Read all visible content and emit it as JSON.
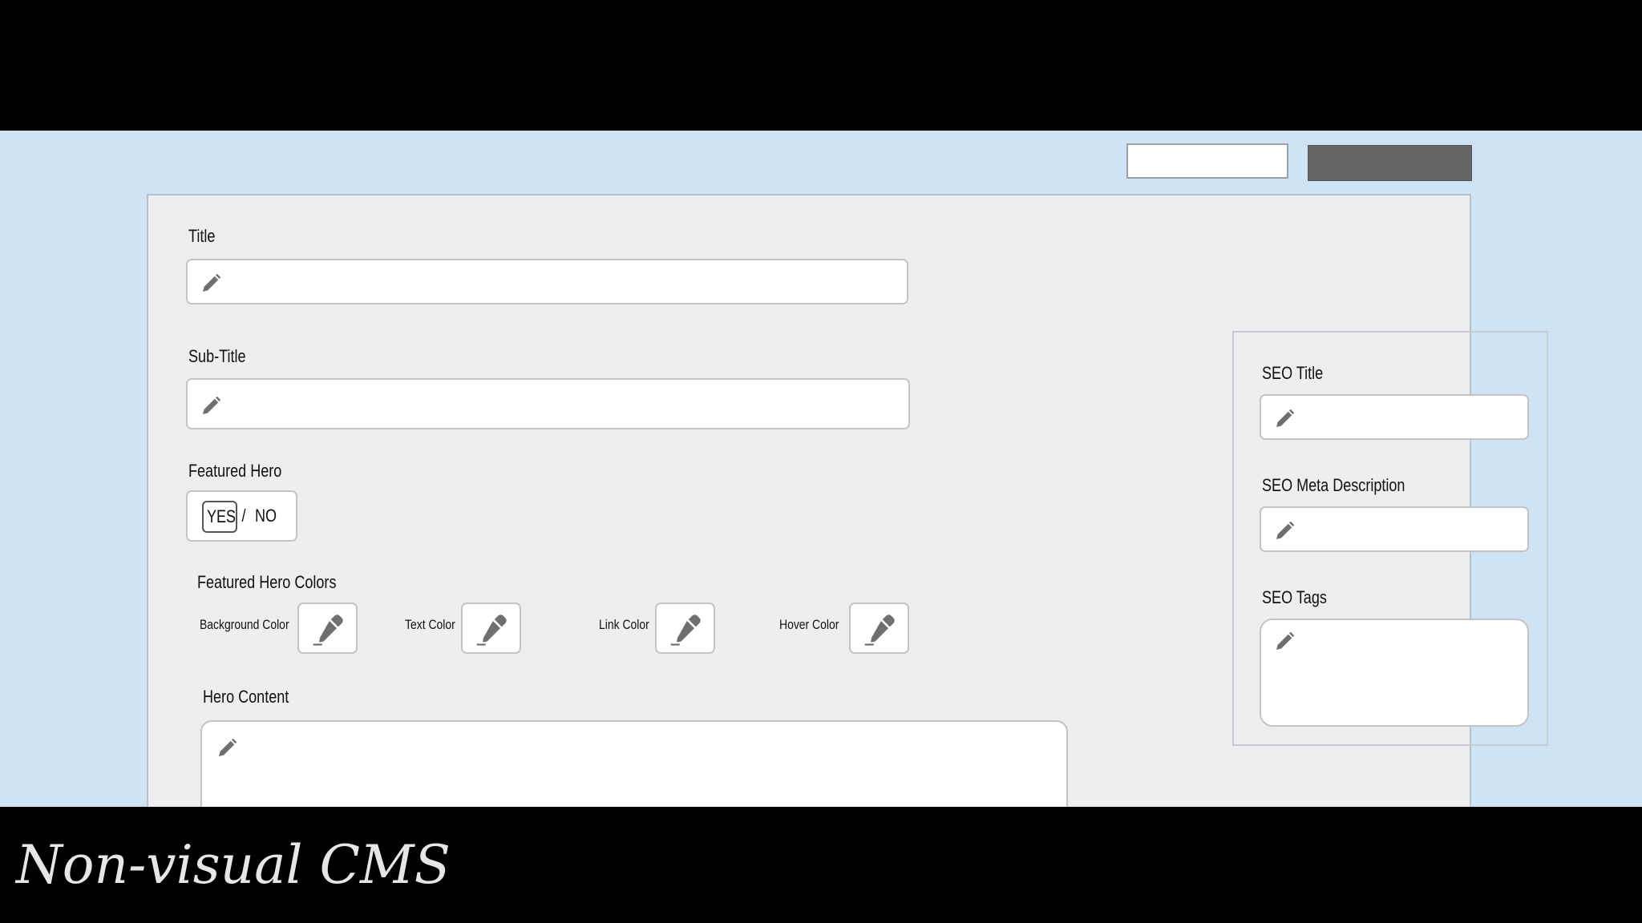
{
  "caption": "Non-visual CMS",
  "form": {
    "title_label": "Title",
    "subtitle_label": "Sub-Title",
    "featured_hero_label": "Featured Hero",
    "featured_hero_toggle": {
      "yes": "YES",
      "separator": "/",
      "no": "NO",
      "selected": "YES"
    },
    "featured_hero_colors_label": "Featured Hero Colors",
    "colors": {
      "background": "Background Color",
      "text": "Text Color",
      "link": "Link Color",
      "hover": "Hover Color"
    },
    "hero_content_label": "Hero Content"
  },
  "seo": {
    "title_label": "SEO Title",
    "meta_label": "SEO Meta Description",
    "tags_label": "SEO Tags"
  },
  "icons": {
    "field": "pencil-icon",
    "color": "eyedropper-icon"
  },
  "colors_theme": {
    "page_bg": "#d0e3f4",
    "panel_bg": "#eeeef0",
    "button_bg": "#646566",
    "icon": "#6f6f6f"
  }
}
